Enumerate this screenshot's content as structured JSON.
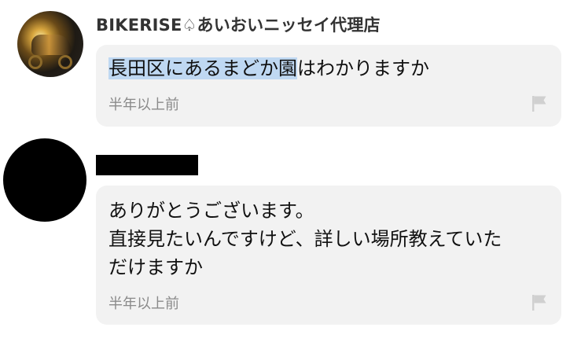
{
  "comments": [
    {
      "username": "BIKERISE♤あいおいニッセイ代理店",
      "message_highlighted": "長田区にあるまどか園",
      "message_rest": "はわかりますか",
      "time": "半年以上前",
      "avatar_icon": "motorcycle-photo",
      "report_icon": "flag-icon"
    },
    {
      "username_redacted": true,
      "message_lines": [
        "ありがとうございます。",
        "直接見たいんですけど、詳しい場所教えていた",
        "だけますか"
      ],
      "time": "半年以上前",
      "avatar_icon": "blacked-out-avatar",
      "report_icon": "flag-icon"
    }
  ],
  "colors": {
    "bubble_bg": "#f2f2f2",
    "highlight": "#bfd8f2",
    "timestamp": "#8a8a8a",
    "flag": "#d0d0d0"
  }
}
